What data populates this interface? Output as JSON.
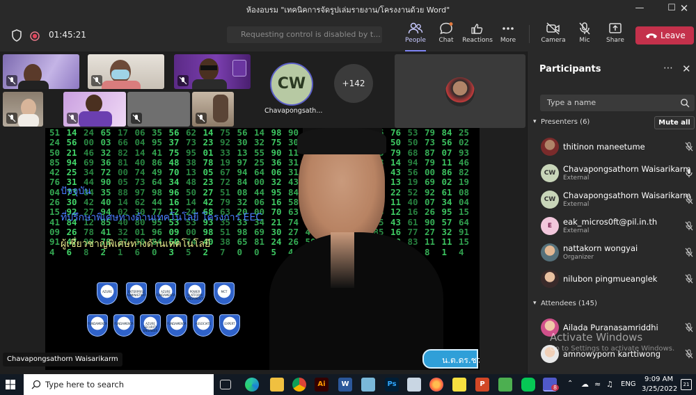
{
  "window": {
    "title": "ห้องอบรม \"เทคนิคการจัดรูปเล่มรายงาน/โครงงานด้วย Word\""
  },
  "meeting": {
    "timer": "01:45:21",
    "request_control": "Requesting control is disabled by t...",
    "toolbar": {
      "people": "People",
      "chat": "Chat",
      "reactions": "Reactions",
      "more": "More",
      "camera": "Camera",
      "mic": "Mic",
      "share": "Share",
      "leave": "Leave"
    },
    "tiles": {
      "cw_initials": "CW",
      "cw_name": "Chavapongsath...",
      "overflow": "+142"
    }
  },
  "shared_screen": {
    "line1": "ปัจจุบัน",
    "line2": "ที่ปรึกษาพิเศษทางด้านเทคโนโลยี โครงการ EEC",
    "line3": "ผู้เชี่ยวชาญพิเศษทางด้านเทคโนโลยี",
    "badges_row1": [
      "AZURE",
      "ENTERPRISE ADMINISTRATOR",
      "AZURE FUNDAMENTALS",
      "POWER PLATFORM FUNDAMENTALS",
      "MCT"
    ],
    "badges_row2": [
      "FUNDAMENTALS",
      "FUNDAMENTALS",
      "AZURE SECURITY ENGINEER",
      "FUNDAMENTALS",
      "ASSOCIATE",
      "EXPERT"
    ],
    "name_tag": "น.ต.ดร.ชว",
    "presenter_caption": "Chavapongsathorn Waisarikarm"
  },
  "participants": {
    "title": "Participants",
    "search_placeholder": "Type a name",
    "presenters_header": "Presenters (6)",
    "mute_all": "Mute all",
    "attendees_header": "Attendees (145)",
    "presenters": [
      {
        "name": "thitinon maneetume",
        "sub": "",
        "initials": "",
        "mic": "off"
      },
      {
        "name": "Chavapongsathorn Waisarikarm",
        "sub": "External",
        "initials": "CW",
        "mic": "on"
      },
      {
        "name": "Chavapongsathorn Waisarikarm",
        "sub": "External",
        "initials": "CW",
        "mic": "off"
      },
      {
        "name": "eak_micros0ft@pil.in.th",
        "sub": "External",
        "initials": "E",
        "mic": "off"
      },
      {
        "name": "nattakorn wongyai",
        "sub": "Organizer",
        "initials": "",
        "mic": "off"
      },
      {
        "name": "nilubon pingmueanglek",
        "sub": "",
        "initials": "",
        "mic": "off"
      }
    ],
    "attendees": [
      {
        "name": "Ailada Puranasamriddhi",
        "sub": "",
        "mic": "off"
      },
      {
        "name": "amnowyporn karttiwong",
        "sub": "",
        "mic": "off"
      }
    ]
  },
  "watermark": {
    "line1": "Activate Windows",
    "line2": "Go to Settings to activate Windows."
  },
  "taskbar": {
    "search_placeholder": "Type here to search",
    "lang": "ENG",
    "time": "9:09 AM",
    "date": "3/25/2022",
    "notif_count": "21",
    "teams_badge": "8"
  },
  "colors": {
    "accent": "#7f85f5",
    "leave": "#c4314b",
    "matrix": "#43d86a",
    "link_text": "#4a7dff"
  }
}
